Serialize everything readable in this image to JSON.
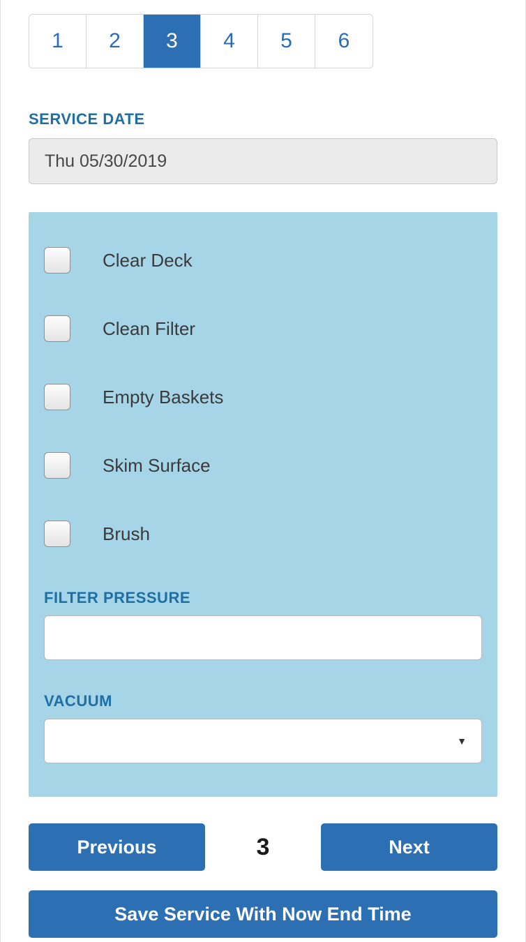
{
  "steps": {
    "items": [
      "1",
      "2",
      "3",
      "4",
      "5",
      "6"
    ],
    "active_index": 2
  },
  "service_date": {
    "label": "SERVICE DATE",
    "value": "Thu 05/30/2019"
  },
  "tasks": [
    {
      "label": "Clear Deck",
      "checked": false
    },
    {
      "label": "Clean Filter",
      "checked": false
    },
    {
      "label": "Empty Baskets",
      "checked": false
    },
    {
      "label": "Skim Surface",
      "checked": false
    },
    {
      "label": "Brush",
      "checked": false
    }
  ],
  "filter_pressure": {
    "label": "FILTER PRESSURE",
    "value": ""
  },
  "vacuum": {
    "label": "VACUUM",
    "value": ""
  },
  "nav": {
    "prev_label": "Previous",
    "page": "3",
    "next_label": "Next"
  },
  "save": {
    "label": "Save Service With Now End Time"
  }
}
